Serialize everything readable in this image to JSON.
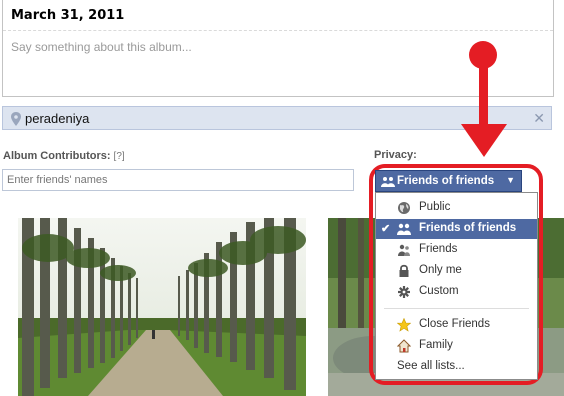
{
  "album": {
    "date": "March 31, 2011",
    "description_placeholder": "Say something about this album...",
    "location": "peradeniya",
    "contributors_label": "Album Contributors:",
    "contributors_help": "[?]",
    "contributors_placeholder": "Enter friends' names"
  },
  "privacy": {
    "label": "Privacy:",
    "selected": "Friends of friends",
    "options": [
      {
        "label": "Public",
        "icon": "globe-icon"
      },
      {
        "label": "Friends of friends",
        "icon": "friends-group-icon",
        "selected": true
      },
      {
        "label": "Friends",
        "icon": "friends-icon"
      },
      {
        "label": "Only me",
        "icon": "lock-icon"
      },
      {
        "label": "Custom",
        "icon": "gear-icon"
      }
    ],
    "lists": [
      {
        "label": "Close Friends",
        "icon": "star-icon"
      },
      {
        "label": "Family",
        "icon": "house-icon"
      }
    ],
    "see_all": "See all lists..."
  },
  "colors": {
    "accent": "#4e69a2",
    "highlight": "#e41d24"
  }
}
